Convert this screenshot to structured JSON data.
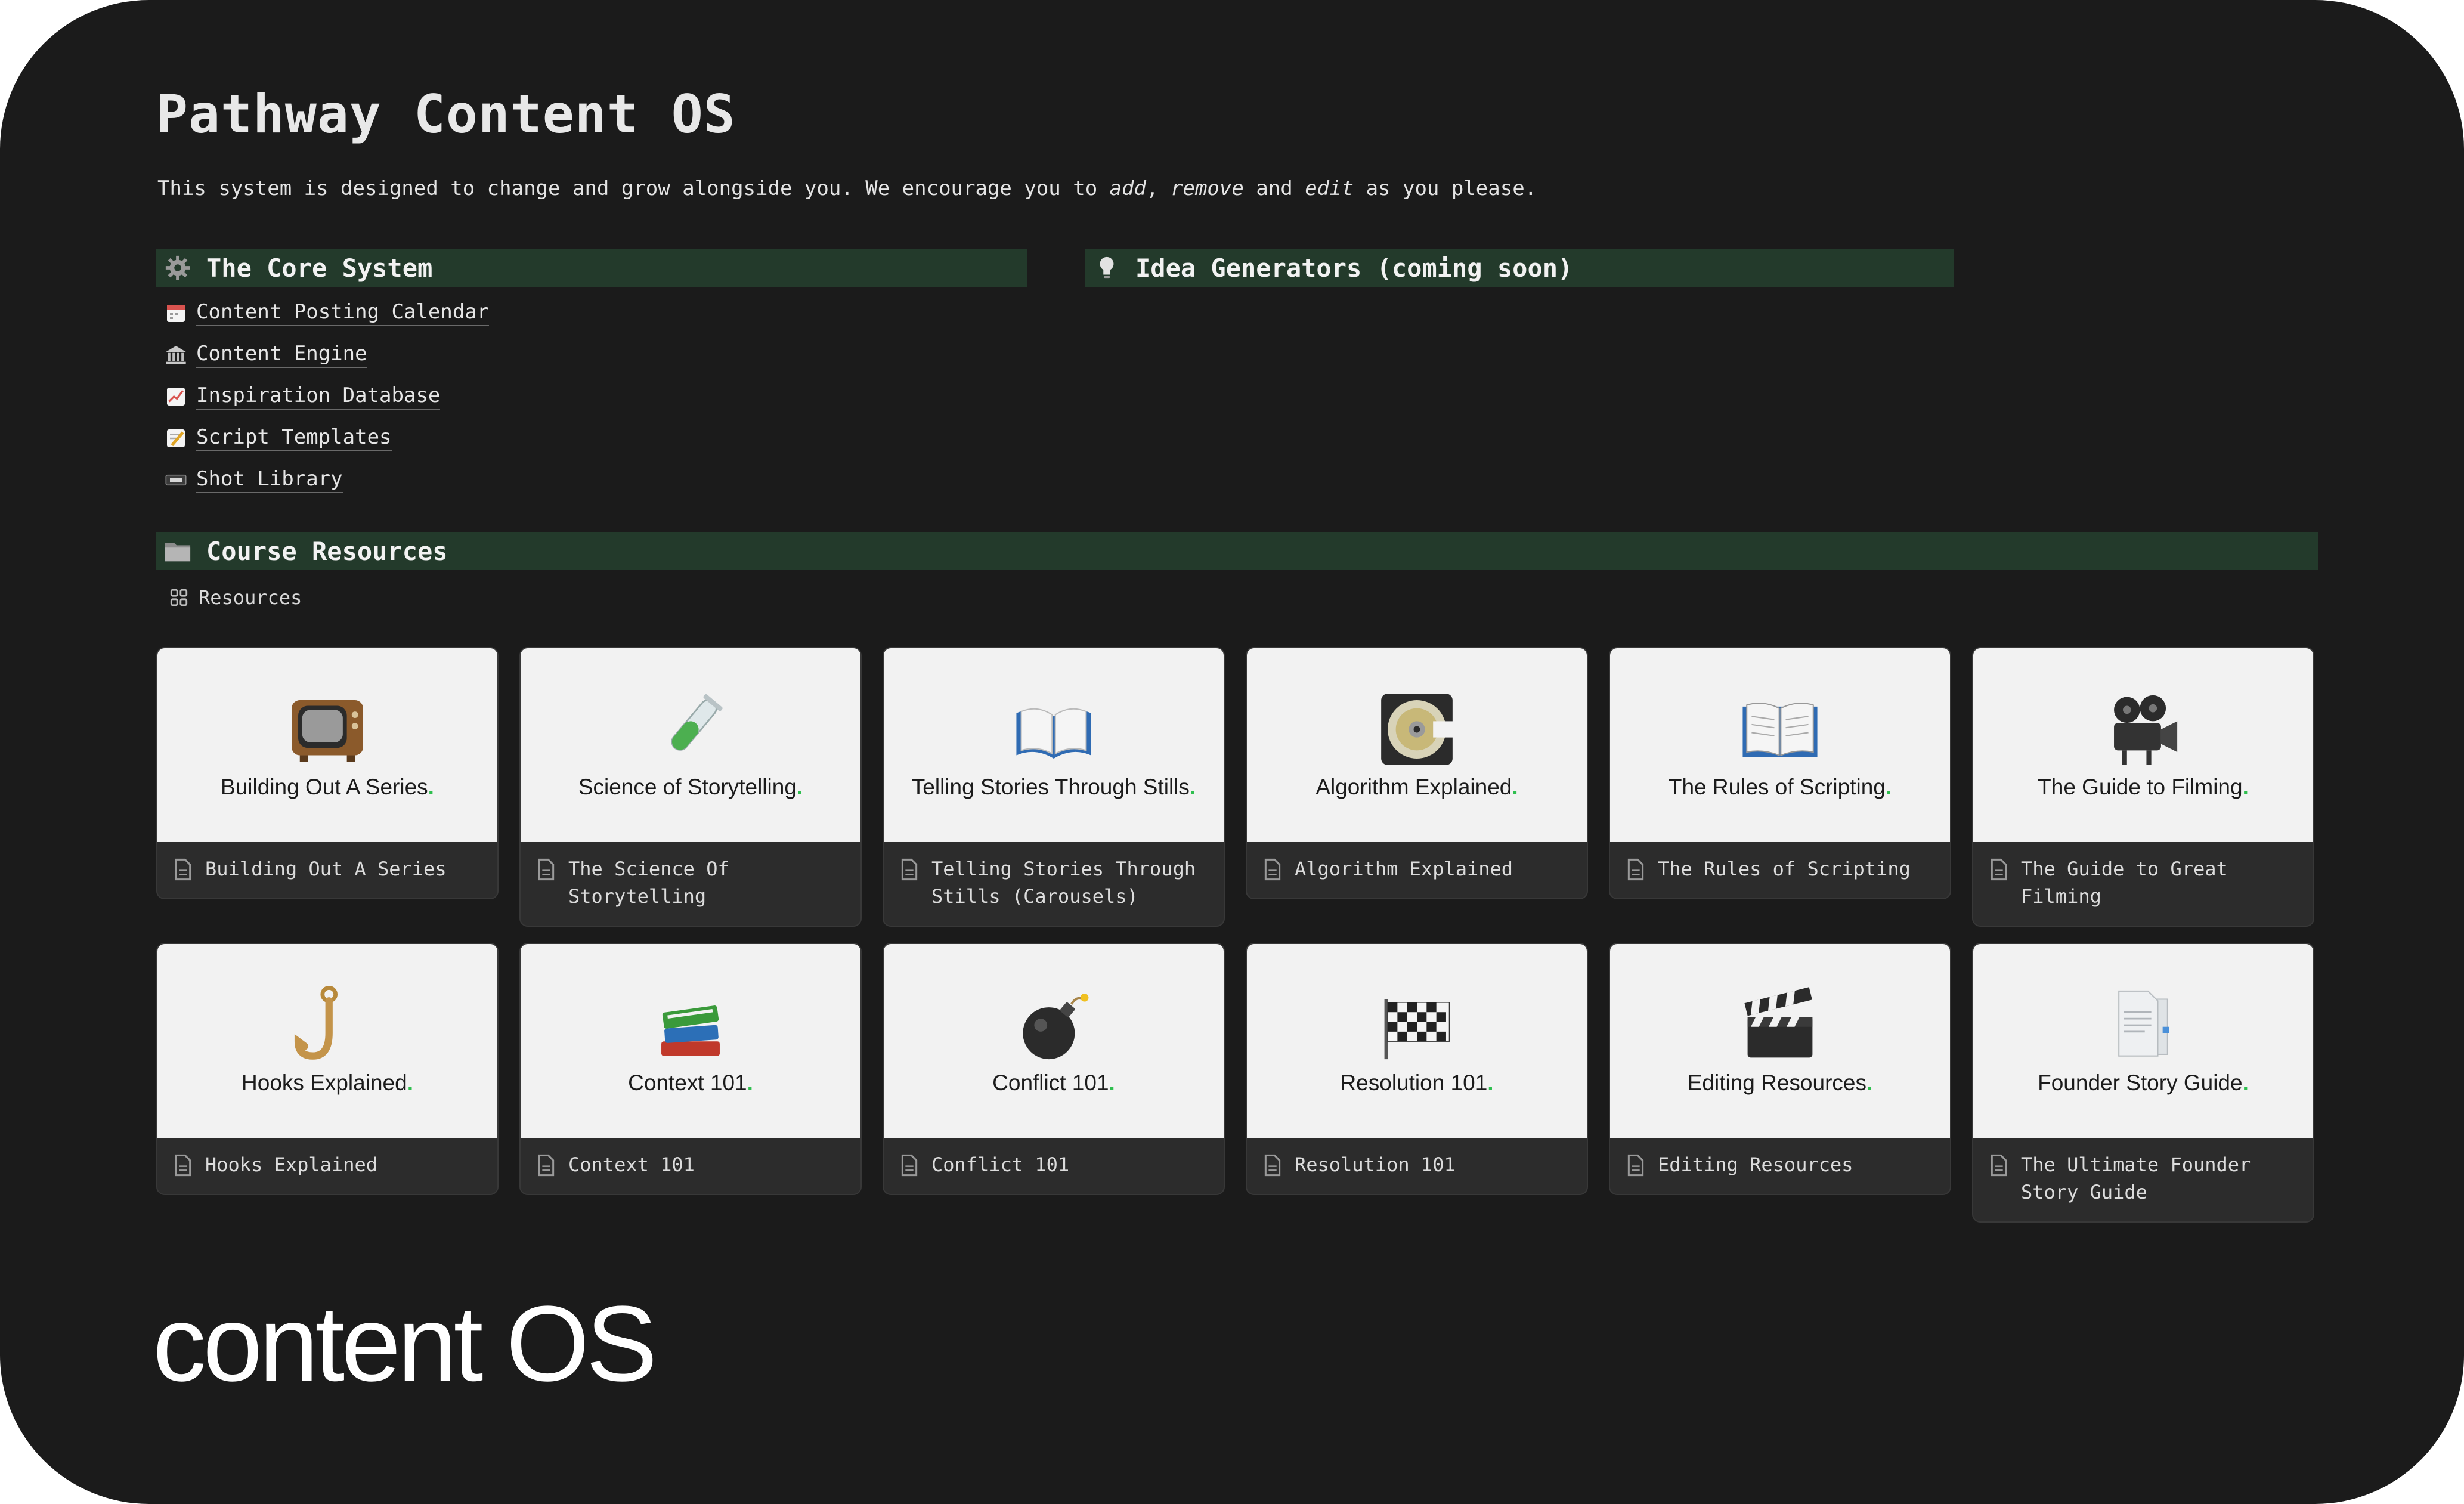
{
  "page": {
    "title": "Pathway Content OS",
    "subtitle_parts": [
      "This system is designed to change and grow alongside you. We encourage you to ",
      "add",
      ", ",
      "remove",
      " and ",
      "edit",
      " as you please."
    ]
  },
  "core_system": {
    "heading": "The Core System",
    "icon": "gear-icon",
    "items": [
      {
        "label": "Content Posting Calendar",
        "icon": "calendar-icon"
      },
      {
        "label": "Content Engine",
        "icon": "bank-icon"
      },
      {
        "label": "Inspiration Database",
        "icon": "chart-increasing-icon"
      },
      {
        "label": "Script Templates",
        "icon": "memo-icon"
      },
      {
        "label": "Shot Library",
        "icon": "video-cassette-icon"
      }
    ]
  },
  "idea_generators": {
    "heading": "Idea Generators (coming soon)",
    "icon": "lightbulb-icon"
  },
  "course_resources": {
    "heading": "Course Resources",
    "icon": "folder-icon",
    "view_label": "Resources",
    "cards": [
      {
        "cover_title": "Building Out A Series",
        "caption": "Building Out A Series",
        "emoji": "television-icon"
      },
      {
        "cover_title": "Science of Storytelling",
        "caption": "The Science Of\nStorytelling",
        "emoji": "test-tube-icon"
      },
      {
        "cover_title": "Telling Stories Through Stills",
        "caption": "Telling Stories Through\nStills (Carousels)",
        "emoji": "open-book-icon"
      },
      {
        "cover_title": "Algorithm Explained",
        "caption": "Algorithm Explained",
        "emoji": "optical-disc-icon"
      },
      {
        "cover_title": "The Rules of Scripting",
        "caption": "The Rules of Scripting",
        "emoji": "open-book-icon"
      },
      {
        "cover_title": "The Guide to Filming",
        "caption": "The Guide to Great\nFilming",
        "emoji": "movie-camera-icon"
      },
      {
        "cover_title": "Hooks Explained",
        "caption": "Hooks Explained",
        "emoji": "hook-icon"
      },
      {
        "cover_title": "Context 101",
        "caption": "Context 101",
        "emoji": "books-icon"
      },
      {
        "cover_title": "Conflict 101",
        "caption": "Conflict 101",
        "emoji": "bomb-icon"
      },
      {
        "cover_title": "Resolution 101",
        "caption": "Resolution 101",
        "emoji": "checkered-flag-icon"
      },
      {
        "cover_title": "Editing Resources",
        "caption": "Editing Resources",
        "emoji": "clapper-board-icon"
      },
      {
        "cover_title": "Founder Story Guide",
        "caption": "The Ultimate Founder\nStory Guide",
        "emoji": "document-icon"
      }
    ]
  },
  "brand": {
    "text": "content OS"
  },
  "colors": {
    "background": "#1b1b1b",
    "section_bar": "#233a2b",
    "card_cover": "#f2f2f2",
    "card_caption": "#2c2c2c",
    "accent_dot": "#2fbf4f"
  }
}
